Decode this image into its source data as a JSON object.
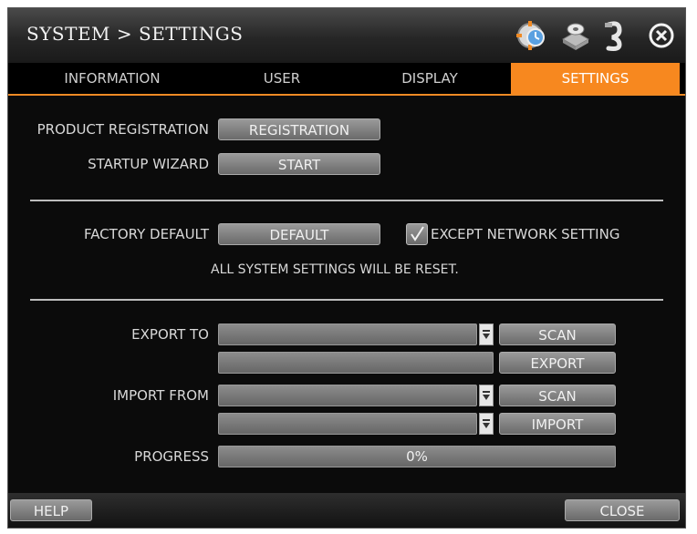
{
  "window": {
    "title": "SYSTEM > SETTINGS",
    "title_icons": [
      "gear-clock-icon",
      "disk-icon",
      "usb-icon",
      "close-circle-icon"
    ]
  },
  "tabs": [
    {
      "label": "INFORMATION",
      "active": false
    },
    {
      "label": "USER",
      "active": false
    },
    {
      "label": "DISPLAY",
      "active": false
    },
    {
      "label": "SETTINGS",
      "active": true
    }
  ],
  "registration": {
    "product_label": "PRODUCT REGISTRATION",
    "product_button": "REGISTRATION",
    "wizard_label": "STARTUP WIZARD",
    "wizard_button": "START"
  },
  "factory": {
    "label": "FACTORY DEFAULT",
    "button": "DEFAULT",
    "except_label": "EXCEPT NETWORK SETTING",
    "except_checked": true,
    "notice": "ALL SYSTEM SETTINGS WILL BE RESET."
  },
  "transfer": {
    "export_label": "EXPORT TO",
    "export_value": "",
    "export_path_value": "",
    "scan_label": "SCAN",
    "export_button": "EXPORT",
    "import_label": "IMPORT FROM",
    "import_value": "",
    "import_file_value": "",
    "import_scan_label": "SCAN",
    "import_button": "IMPORT",
    "progress_label": "PROGRESS",
    "progress_text": "0%",
    "progress_value": 0
  },
  "footer": {
    "help": "HELP",
    "close": "CLOSE"
  },
  "colors": {
    "accent": "#f7881f",
    "background": "#0b0b0b"
  }
}
